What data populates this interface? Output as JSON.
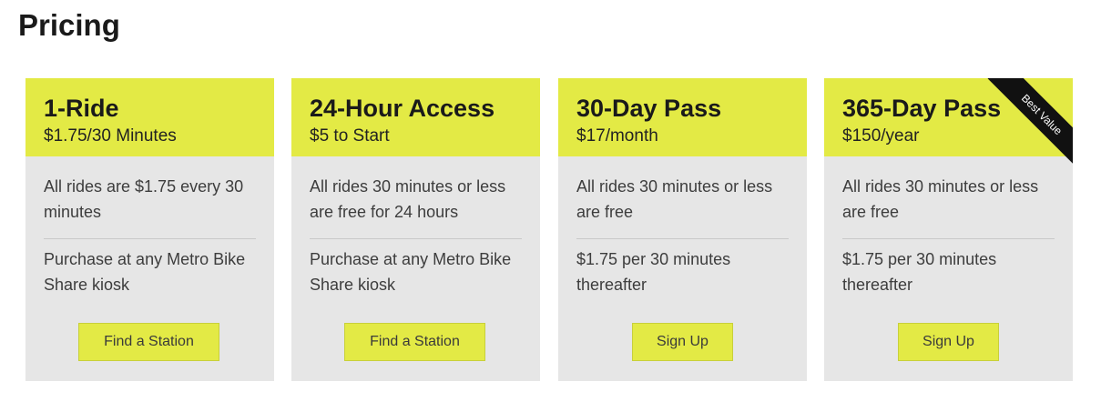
{
  "page": {
    "title": "Pricing"
  },
  "colors": {
    "accent": "#e3ea45",
    "card_bg": "#e6e6e6",
    "ribbon": "#111111"
  },
  "plans": [
    {
      "name": "1-Ride",
      "price": "$1.75/30 Minutes",
      "feature_1": "All rides are $1.75 every 30 minutes",
      "feature_2": "Purchase at any Metro Bike Share kiosk",
      "button": "Find a Station"
    },
    {
      "name": "24-Hour Access",
      "price": "$5 to Start",
      "feature_1": "All rides 30 minutes or less are free for 24 hours",
      "feature_2": "Purchase at any Metro Bike Share kiosk",
      "button": "Find a Station"
    },
    {
      "name": "30-Day Pass",
      "price": "$17/month",
      "feature_1": "All rides 30 minutes or less are free",
      "feature_2": "$1.75 per 30 minutes thereafter",
      "button": "Sign Up"
    },
    {
      "name": "365-Day Pass",
      "price": "$150/year",
      "feature_1": "All rides 30 minutes or less are free",
      "feature_2": "$1.75 per 30 minutes thereafter",
      "button": "Sign Up",
      "badge": "Best Value"
    }
  ]
}
